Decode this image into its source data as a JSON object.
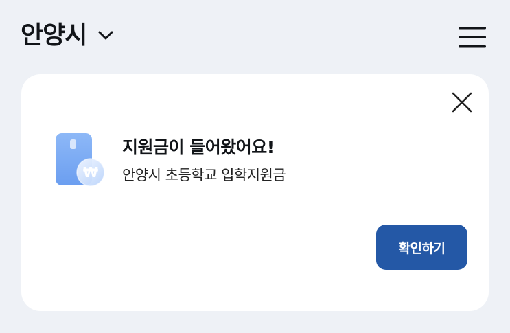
{
  "header": {
    "city_name": "안양시",
    "city_dropdown_icon": "chevron-down-icon",
    "menu_icon": "hamburger-menu-icon"
  },
  "notification_card": {
    "close_icon": "close-icon",
    "card_icon": "wallet-card-won-icon",
    "currency_symbol": "₩",
    "title": "지원금이 들어왔어요!",
    "subtitle": "안양시 초등학교 입학지원금",
    "confirm_label": "확인하기"
  },
  "colors": {
    "background": "#eef1f6",
    "card": "#ffffff",
    "primary_button": "#2458a6",
    "card_icon_blue": "#7eaef5"
  }
}
